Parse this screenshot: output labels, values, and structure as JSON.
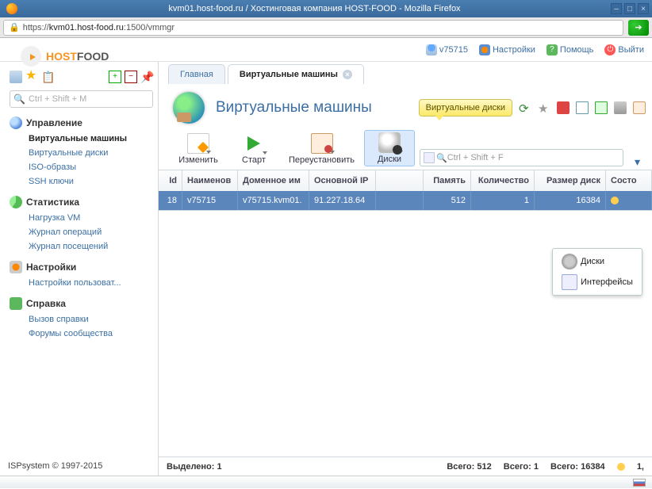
{
  "browser": {
    "title": "kvm01.host-food.ru / Хостинговая компания HOST-FOOD - Mozilla Firefox",
    "url_prefix": "https://",
    "url_host": "kvm01.host-food.ru",
    "url_path": ":1500/vmmgr"
  },
  "logo": {
    "brand1": "HOST",
    "brand2": "FOOD"
  },
  "top": {
    "user": "v75715",
    "settings": "Настройки",
    "help": "Помощь",
    "logout": "Выйти"
  },
  "sidebar": {
    "search_placeholder": "Ctrl + Shift + M",
    "groups": [
      {
        "title": "Управление",
        "items": [
          "Виртуальные машины",
          "Виртуальные диски",
          "ISO-образы",
          "SSH ключи"
        ],
        "active_index": 0
      },
      {
        "title": "Статистика",
        "items": [
          "Нагрузка VM",
          "Журнал операций",
          "Журнал посещений"
        ]
      },
      {
        "title": "Настройки",
        "items": [
          "Настройки пользоват..."
        ]
      },
      {
        "title": "Справка",
        "items": [
          "Вызов справки",
          "Форумы сообщества"
        ]
      }
    ],
    "footer": "ISPsystem © 1997-2015"
  },
  "tabs": {
    "t0": "Главная",
    "t1": "Виртуальные машины"
  },
  "page": {
    "title": "Виртуальные машины",
    "tooltip": "Виртуальные диски"
  },
  "toolbar": {
    "edit": "Изменить",
    "start": "Старт",
    "reinstall": "Переустановить",
    "disks": "Диски",
    "search_placeholder": "Ctrl + Shift + F"
  },
  "submenu": {
    "disks": "Диски",
    "interfaces": "Интерфейсы"
  },
  "grid": {
    "headers": {
      "id": "Id",
      "name": "Наименов",
      "domain": "Доменное им",
      "ip": "Основной IP",
      "proc": "",
      "mem": "Память",
      "qty": "Количество",
      "disk": "Размер диск",
      "state": "Состо"
    },
    "rows": [
      {
        "id": "18",
        "name": "v75715",
        "domain": "v75715.kvm01.",
        "ip": "91.227.18.64",
        "proc": "",
        "mem": "512",
        "qty": "1",
        "disk": "16384",
        "state": ""
      }
    ]
  },
  "statusbar": {
    "selected_label": "Выделено: 1",
    "total_mem": "Всего: 512",
    "total_qty": "Всего: 1",
    "total_disk": "Всего: 16384",
    "page": "1,"
  }
}
